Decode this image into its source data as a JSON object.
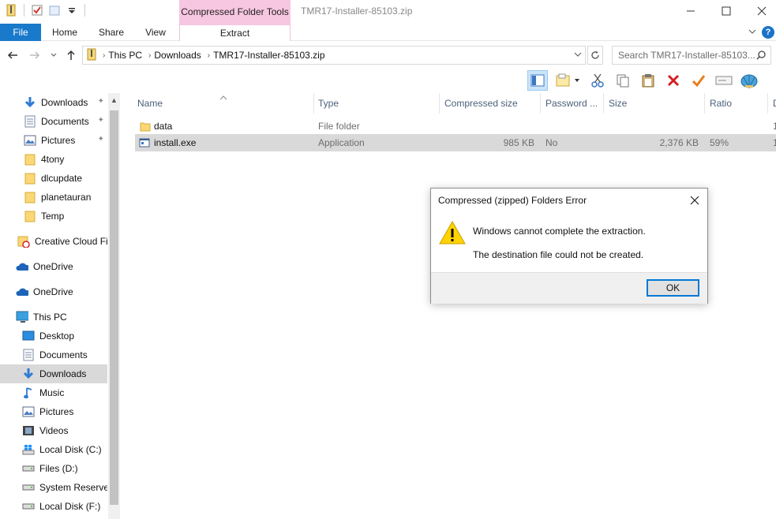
{
  "window": {
    "title": "TMR17-Installer-85103.zip",
    "context_tab_header": "Compressed Folder Tools"
  },
  "ribbon": {
    "tabs": [
      "File",
      "Home",
      "Share",
      "View"
    ],
    "context_tab": "Extract"
  },
  "address": {
    "crumbs": [
      "This PC",
      "Downloads",
      "TMR17-Installer-85103.zip"
    ],
    "search_placeholder": "Search TMR17-Installer-85103..."
  },
  "sidebar": {
    "items": [
      {
        "label": "Downloads",
        "icon": "download-arrow-icon",
        "pinned": true
      },
      {
        "label": "Documents",
        "icon": "document-icon",
        "pinned": true
      },
      {
        "label": "Pictures",
        "icon": "pictures-icon",
        "pinned": true
      },
      {
        "label": "4tony",
        "icon": "folder-icon"
      },
      {
        "label": "dlcupdate",
        "icon": "folder-icon"
      },
      {
        "label": "planetauran",
        "icon": "folder-icon"
      },
      {
        "label": "Temp",
        "icon": "folder-icon"
      },
      {
        "label": "Creative Cloud Fil",
        "icon": "creative-cloud-icon"
      },
      {
        "label": "OneDrive",
        "icon": "onedrive-icon"
      },
      {
        "label": "OneDrive",
        "icon": "onedrive-icon"
      },
      {
        "label": "This PC",
        "icon": "computer-icon"
      },
      {
        "label": "Desktop",
        "icon": "desktop-icon"
      },
      {
        "label": "Documents",
        "icon": "document-icon"
      },
      {
        "label": "Downloads",
        "icon": "download-arrow-icon",
        "selected": true
      },
      {
        "label": "Music",
        "icon": "music-icon"
      },
      {
        "label": "Pictures",
        "icon": "pictures-icon"
      },
      {
        "label": "Videos",
        "icon": "videos-icon"
      },
      {
        "label": "Local Disk (C:)",
        "icon": "windows-drive-icon"
      },
      {
        "label": "Files (D:)",
        "icon": "drive-icon"
      },
      {
        "label": "System Reserved",
        "icon": "drive-icon"
      },
      {
        "label": "Local Disk (F:)",
        "icon": "drive-icon"
      }
    ]
  },
  "columns": [
    "Name",
    "Type",
    "Compressed size",
    "Password ...",
    "Size",
    "Ratio",
    "D"
  ],
  "files": [
    {
      "name": "data",
      "type": "File folder",
      "compressed_size": "",
      "password": "",
      "size": "",
      "ratio": "",
      "date": "1"
    },
    {
      "name": "install.exe",
      "type": "Application",
      "compressed_size": "985 KB",
      "password": "No",
      "size": "2,376 KB",
      "ratio": "59%",
      "date": "1"
    }
  ],
  "dialog": {
    "title": "Compressed (zipped) Folders Error",
    "message": "Windows cannot complete the extraction.",
    "detail": "The destination file could not be created.",
    "ok_label": "OK"
  },
  "colors": {
    "file_tab": "#1979ca",
    "context_tab": "#f7c6e0",
    "selection": "#d9d9d9",
    "dialog_focus": "#0078d7",
    "warning_yellow": "#ffd200"
  }
}
